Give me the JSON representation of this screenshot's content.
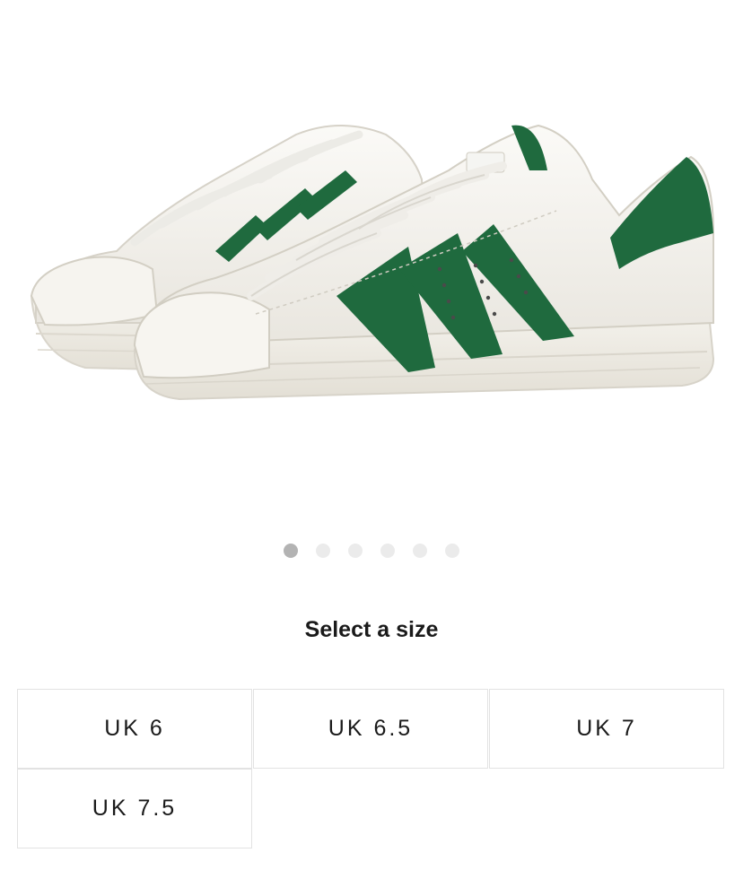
{
  "gallery": {
    "image_label": "shoe-product-image",
    "dots": [
      {
        "active": true
      },
      {
        "active": false
      },
      {
        "active": false
      },
      {
        "active": false
      },
      {
        "active": false
      },
      {
        "active": false
      }
    ]
  },
  "size_selector": {
    "title": "Select a size",
    "sizes": [
      "UK 6",
      "UK 6.5",
      "UK 7",
      "UK 7.5"
    ]
  },
  "colors": {
    "stripe_green": "#1f6a3e",
    "shoe_white": "#f3f1ec",
    "sole_cream": "#efece4",
    "dot_active": "#b3b3b3",
    "dot_inactive": "#ebebeb",
    "cell_border": "#e2e2e2"
  }
}
